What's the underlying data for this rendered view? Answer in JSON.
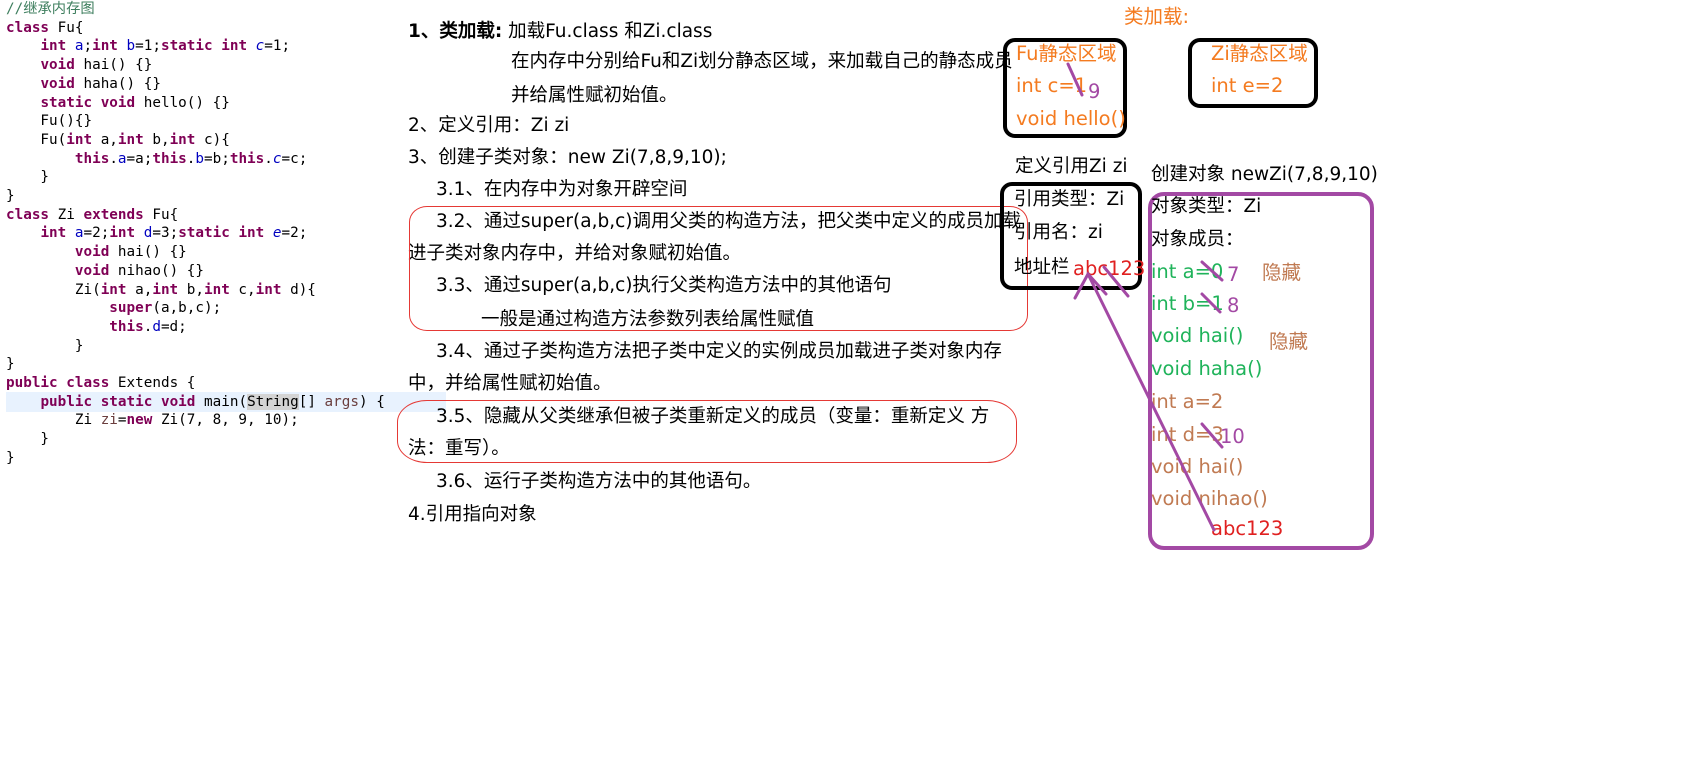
{
  "code": {
    "lines": [
      [
        {
          "c": "cm",
          "t": "//继承内存图"
        }
      ],
      [
        {
          "c": "kw",
          "t": "class"
        },
        {
          "c": "",
          "t": " Fu{"
        }
      ],
      [
        {
          "c": "",
          "t": "    "
        },
        {
          "c": "kw",
          "t": "int"
        },
        {
          "c": "",
          "t": " "
        },
        {
          "c": "fld",
          "t": "a"
        },
        {
          "c": "",
          "t": ";"
        },
        {
          "c": "kw",
          "t": "int"
        },
        {
          "c": "",
          "t": " "
        },
        {
          "c": "fld",
          "t": "b"
        },
        {
          "c": "",
          "t": "=1;"
        },
        {
          "c": "kw",
          "t": "static"
        },
        {
          "c": "",
          "t": " "
        },
        {
          "c": "kw",
          "t": "int"
        },
        {
          "c": "",
          "t": " "
        },
        {
          "c": "sfld",
          "t": "c"
        },
        {
          "c": "",
          "t": "=1;"
        }
      ],
      [
        {
          "c": "",
          "t": "    "
        },
        {
          "c": "kw",
          "t": "void"
        },
        {
          "c": "",
          "t": " hai() {}"
        }
      ],
      [
        {
          "c": "",
          "t": "    "
        },
        {
          "c": "kw",
          "t": "void"
        },
        {
          "c": "",
          "t": " haha() {}"
        }
      ],
      [
        {
          "c": "",
          "t": "    "
        },
        {
          "c": "kw",
          "t": "static"
        },
        {
          "c": "",
          "t": " "
        },
        {
          "c": "kw",
          "t": "void"
        },
        {
          "c": "",
          "t": " hello() {}"
        }
      ],
      [
        {
          "c": "",
          "t": "    Fu(){}"
        }
      ],
      [
        {
          "c": "",
          "t": "    Fu("
        },
        {
          "c": "kw",
          "t": "int"
        },
        {
          "c": "",
          "t": " a,"
        },
        {
          "c": "kw",
          "t": "int"
        },
        {
          "c": "",
          "t": " b,"
        },
        {
          "c": "kw",
          "t": "int"
        },
        {
          "c": "",
          "t": " c){"
        }
      ],
      [
        {
          "c": "",
          "t": "        "
        },
        {
          "c": "kw",
          "t": "this"
        },
        {
          "c": "",
          "t": "."
        },
        {
          "c": "fld",
          "t": "a"
        },
        {
          "c": "",
          "t": "=a;"
        },
        {
          "c": "kw",
          "t": "this"
        },
        {
          "c": "",
          "t": "."
        },
        {
          "c": "fld",
          "t": "b"
        },
        {
          "c": "",
          "t": "=b;"
        },
        {
          "c": "kw",
          "t": "this"
        },
        {
          "c": "",
          "t": "."
        },
        {
          "c": "sfld",
          "t": "c"
        },
        {
          "c": "",
          "t": "=c;"
        }
      ],
      [
        {
          "c": "",
          "t": "    }"
        }
      ],
      [
        {
          "c": "",
          "t": "}"
        }
      ],
      [
        {
          "c": "kw",
          "t": "class"
        },
        {
          "c": "",
          "t": " Zi "
        },
        {
          "c": "kw",
          "t": "extends"
        },
        {
          "c": "",
          "t": " Fu{"
        }
      ],
      [
        {
          "c": "",
          "t": "    "
        },
        {
          "c": "kw",
          "t": "int"
        },
        {
          "c": "",
          "t": " "
        },
        {
          "c": "fld",
          "t": "a"
        },
        {
          "c": "",
          "t": "=2;"
        },
        {
          "c": "kw",
          "t": "int"
        },
        {
          "c": "",
          "t": " "
        },
        {
          "c": "fld",
          "t": "d"
        },
        {
          "c": "",
          "t": "=3;"
        },
        {
          "c": "kw",
          "t": "static"
        },
        {
          "c": "",
          "t": " "
        },
        {
          "c": "kw",
          "t": "int"
        },
        {
          "c": "",
          "t": " "
        },
        {
          "c": "sfld",
          "t": "e"
        },
        {
          "c": "",
          "t": "=2;"
        }
      ],
      [
        {
          "c": "",
          "t": "        "
        },
        {
          "c": "kw",
          "t": "void"
        },
        {
          "c": "",
          "t": " hai() {}"
        }
      ],
      [
        {
          "c": "",
          "t": "        "
        },
        {
          "c": "kw",
          "t": "void"
        },
        {
          "c": "",
          "t": " nihao() {}"
        }
      ],
      [
        {
          "c": "",
          "t": "        Zi("
        },
        {
          "c": "kw",
          "t": "int"
        },
        {
          "c": "",
          "t": " a,"
        },
        {
          "c": "kw",
          "t": "int"
        },
        {
          "c": "",
          "t": " b,"
        },
        {
          "c": "kw",
          "t": "int"
        },
        {
          "c": "",
          "t": " c,"
        },
        {
          "c": "kw",
          "t": "int"
        },
        {
          "c": "",
          "t": " d){"
        }
      ],
      [
        {
          "c": "",
          "t": "            "
        },
        {
          "c": "kw",
          "t": "super"
        },
        {
          "c": "",
          "t": "(a,b,c);"
        }
      ],
      [
        {
          "c": "",
          "t": "            "
        },
        {
          "c": "kw",
          "t": "this"
        },
        {
          "c": "",
          "t": "."
        },
        {
          "c": "fld",
          "t": "d"
        },
        {
          "c": "",
          "t": "=d;"
        }
      ],
      [
        {
          "c": "",
          "t": "        }"
        }
      ],
      [
        {
          "c": "",
          "t": "}"
        }
      ],
      [
        {
          "c": "kw",
          "t": "public"
        },
        {
          "c": "",
          "t": " "
        },
        {
          "c": "kw",
          "t": "class"
        },
        {
          "c": "",
          "t": " Extends {"
        }
      ],
      [
        {
          "c": "",
          "t": "    "
        },
        {
          "c": "kw",
          "t": "public"
        },
        {
          "c": "",
          "t": " "
        },
        {
          "c": "kw",
          "t": "static"
        },
        {
          "c": "",
          "t": " "
        },
        {
          "c": "kw",
          "t": "void"
        },
        {
          "c": "",
          "t": " main("
        },
        {
          "c": "cursor-sel",
          "t": "String"
        },
        {
          "c": "",
          "t": "[] "
        },
        {
          "c": "lvar",
          "t": "args"
        },
        {
          "c": "",
          "t": ") {"
        }
      ],
      [
        {
          "c": "",
          "t": "        Zi "
        },
        {
          "c": "lvar",
          "t": "zi"
        },
        {
          "c": "",
          "t": "="
        },
        {
          "c": "kw",
          "t": "new"
        },
        {
          "c": "",
          "t": " Zi(7, 8, 9, 10);"
        }
      ],
      [
        {
          "c": "",
          "t": "    }"
        }
      ],
      [
        {
          "c": "",
          "t": "}"
        }
      ]
    ],
    "highlight_line": 21
  },
  "explain": {
    "s1_label": "1、类加载:",
    "s1_text": "加载Fu.class 和Zi.class",
    "s1_line2": "在内存中分别给Fu和Zi划分静态区域，来加载自己的静态成员",
    "s1_line3": "并给属性赋初始值。",
    "s2": "2、定义引用：Zi zi",
    "s3": "3、创建子类对象：new Zi(7,8,9,10);",
    "s3_1": "3.1、在内存中为对象开辟空间",
    "s3_2a": "3.2、通过super(a,b,c)调用父类的构造方法，把父类中定义的成员加载",
    "s3_2b": "进子类对象内存中，并给对象赋初始值。",
    "s3_3a": "3.3、通过super(a,b,c)执行父类构造方法中的其他语句",
    "s3_3b": "一般是通过构造方法参数列表给属性赋值",
    "s3_4a": "3.4、通过子类构造方法把子类中定义的实例成员加载进子类对象内存",
    "s3_4b": "中，并给属性赋初始值。",
    "s3_5a": "3.5、隐藏从父类继承但被子类重新定义的成员（变量：重新定义 方",
    "s3_5b": "法：重写）。",
    "s3_6": "3.6、运行子类构造方法中的其他语句。",
    "s4": "4.引用指向对象"
  },
  "memory": {
    "class_load_title": "类加载:",
    "fu_static": {
      "title": "Fu静态区域",
      "field": "int c=1",
      "method": "void hello()",
      "new_value": "9"
    },
    "zi_static": {
      "title": "Zi静态区域",
      "field": "int e=2"
    },
    "ref_title": "定义引用Zi zi",
    "ref": {
      "type": "引用类型：Zi",
      "name": "引用名：zi",
      "addr_label": "地址栏",
      "addr_value": "abc123"
    },
    "obj_title": "创建对象 newZi(7,8,9,10)",
    "obj": {
      "type": "对象类型：Zi",
      "members_label": "对象成员：",
      "fu_a": "int a=0",
      "fu_a_new": "7",
      "fu_b": "int b=1",
      "fu_b_new": "8",
      "fu_hai": "void hai()",
      "fu_haha": "void haha()",
      "zi_a": "int a=2",
      "zi_d": "int d=3",
      "zi_d_new": "10",
      "zi_hai": "void hai()",
      "zi_nihao": "void nihao()",
      "addr": "abc123",
      "hidden1": "隐藏",
      "hidden2": "隐藏"
    }
  },
  "colors": {
    "orange": "#f47b20",
    "green": "#1fb35a",
    "brown": "#c07a52",
    "purple": "#a349a4",
    "red": "#e02020",
    "keyword": "#7f0055"
  }
}
